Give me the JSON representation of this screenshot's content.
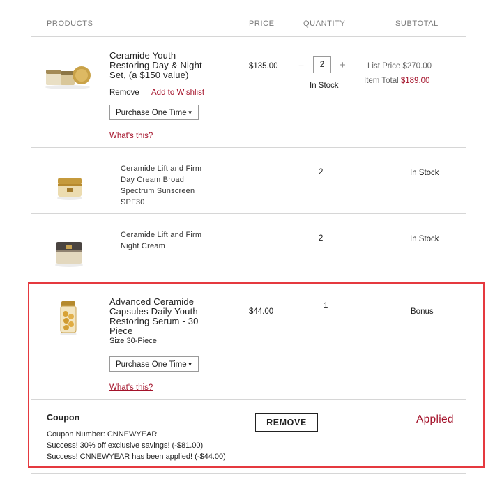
{
  "header": {
    "products": "PRODUCTS",
    "price": "PRICE",
    "quantity": "QUANTITY",
    "subtotal": "SUBTOTAL"
  },
  "items": [
    {
      "name_lines": [
        "Ceramide Youth",
        "Restoring Day & Night",
        "Set, (a $150 value)"
      ],
      "price": "$135.00",
      "qty": "2",
      "qty_minus": "−",
      "qty_plus": "+",
      "stock": "In Stock",
      "list_price_label": "List Price",
      "list_price": "$270.00",
      "item_total_label": "Item Total",
      "item_total": "$189.00",
      "remove_label": "Remove",
      "wishlist_label": "Add to Wishlist",
      "purchase_option": "Purchase One Time",
      "whats_this": "What's this?"
    }
  ],
  "sub_items": [
    {
      "name_lines": [
        "Ceramide Lift and Firm",
        "Day Cream Broad",
        "Spectrum Sunscreen",
        "SPF30"
      ],
      "qty": "2",
      "status": "In Stock"
    },
    {
      "name_lines": [
        "Ceramide Lift and Firm",
        "Night Cream"
      ],
      "qty": "2",
      "status": "In Stock"
    }
  ],
  "bonus": {
    "name_lines": [
      "Advanced Ceramide",
      "Capsules Daily Youth",
      "Restoring Serum - 30",
      "Piece"
    ],
    "size": "Size 30-Piece",
    "price": "$44.00",
    "qty": "1",
    "status": "Bonus",
    "purchase_option": "Purchase One Time",
    "whats_this": "What's this?"
  },
  "coupon": {
    "title": "Coupon",
    "number_line": "Coupon Number: CNNEWYEAR",
    "success1": "Success! 30% off exclusive savings! (-$81.00)",
    "success2": "Success! CNNEWYEAR has been applied! (-$44.00)",
    "remove_button": "REMOVE",
    "status": "Applied"
  },
  "colors": {
    "accent_red": "#a4122a",
    "highlight_border": "#e5393f"
  },
  "icons": {
    "dropdown": "caret-down-icon"
  }
}
